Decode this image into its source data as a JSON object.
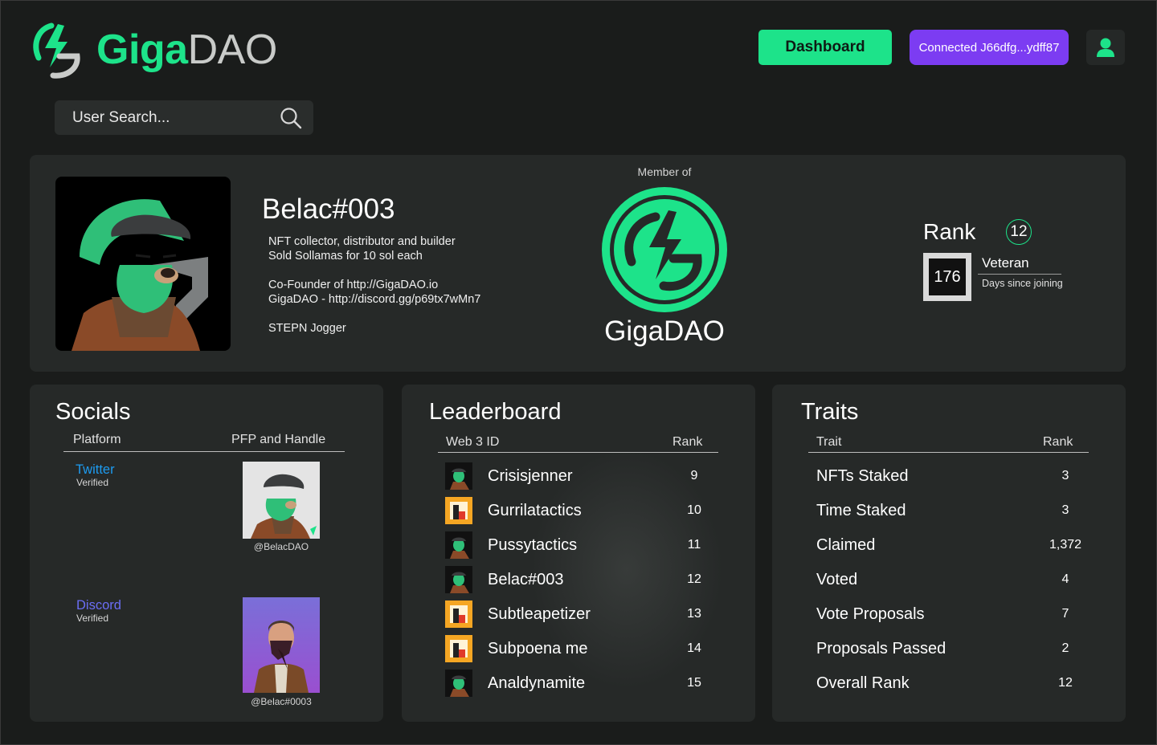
{
  "brand": {
    "name_part1": "Giga",
    "name_part2": "DAO",
    "accent": "#1de38a"
  },
  "header": {
    "dashboard_label": "Dashboard",
    "wallet_label": "Connected J66dfg...ydff87",
    "wallet_color": "#7c3cf2"
  },
  "search": {
    "placeholder": "User Search..."
  },
  "profile": {
    "username": "Belac#003",
    "bio": [
      "NFT collector, distributor and builder",
      "Sold Sollamas for 10 sol each",
      "",
      "Co-Founder of  http://GigaDAO.io",
      "GigaDAO - http://discord.gg/p69tx7wMn7",
      "",
      "STEPN Jogger"
    ],
    "member_of_label": "Member of",
    "member_of_name": "GigaDAO",
    "rank_label": "Rank",
    "rank": "12",
    "days": "176",
    "tier": "Veteran",
    "days_label": "Days since joining"
  },
  "socials": {
    "title": "Socials",
    "col_platform": "Platform",
    "col_handle": "PFP and Handle",
    "items": [
      {
        "platform": "Twitter",
        "status": "Verified",
        "handle": "@BelacDAO",
        "color": "#1d9bf0"
      },
      {
        "platform": "Discord",
        "status": "Verified",
        "handle": "@Belac#0003",
        "color": "#6b6ef5"
      }
    ]
  },
  "leaderboard": {
    "title": "Leaderboard",
    "col_id": "Web 3 ID",
    "col_rank": "Rank",
    "rows": [
      {
        "name": "Crisisjenner",
        "rank": "9",
        "icon": "bear-avatar-icon"
      },
      {
        "name": "Gurrilatactics",
        "rank": "10",
        "icon": "pixel-avatar-icon"
      },
      {
        "name": "Pussytactics",
        "rank": "11",
        "icon": "bear-avatar-icon"
      },
      {
        "name": "Belac#003",
        "rank": "12",
        "icon": "bear-avatar-icon"
      },
      {
        "name": "Subtleapetizer",
        "rank": "13",
        "icon": "pixel-avatar-icon"
      },
      {
        "name": "Subpoena me",
        "rank": "14",
        "icon": "pixel-avatar-icon"
      },
      {
        "name": "Analdynamite",
        "rank": "15",
        "icon": "bear-avatar-icon"
      }
    ]
  },
  "traits": {
    "title": "Traits",
    "col_trait": "Trait",
    "col_rank": "Rank",
    "rows": [
      {
        "name": "NFTs Staked",
        "value": "3"
      },
      {
        "name": "Time Staked",
        "value": "3"
      },
      {
        "name": "Claimed",
        "value": "1,372"
      },
      {
        "name": "Voted",
        "value": "4"
      },
      {
        "name": "Vote Proposals",
        "value": "7"
      },
      {
        "name": "Proposals Passed",
        "value": "2"
      },
      {
        "name": "Overall Rank",
        "value": "12"
      }
    ]
  }
}
